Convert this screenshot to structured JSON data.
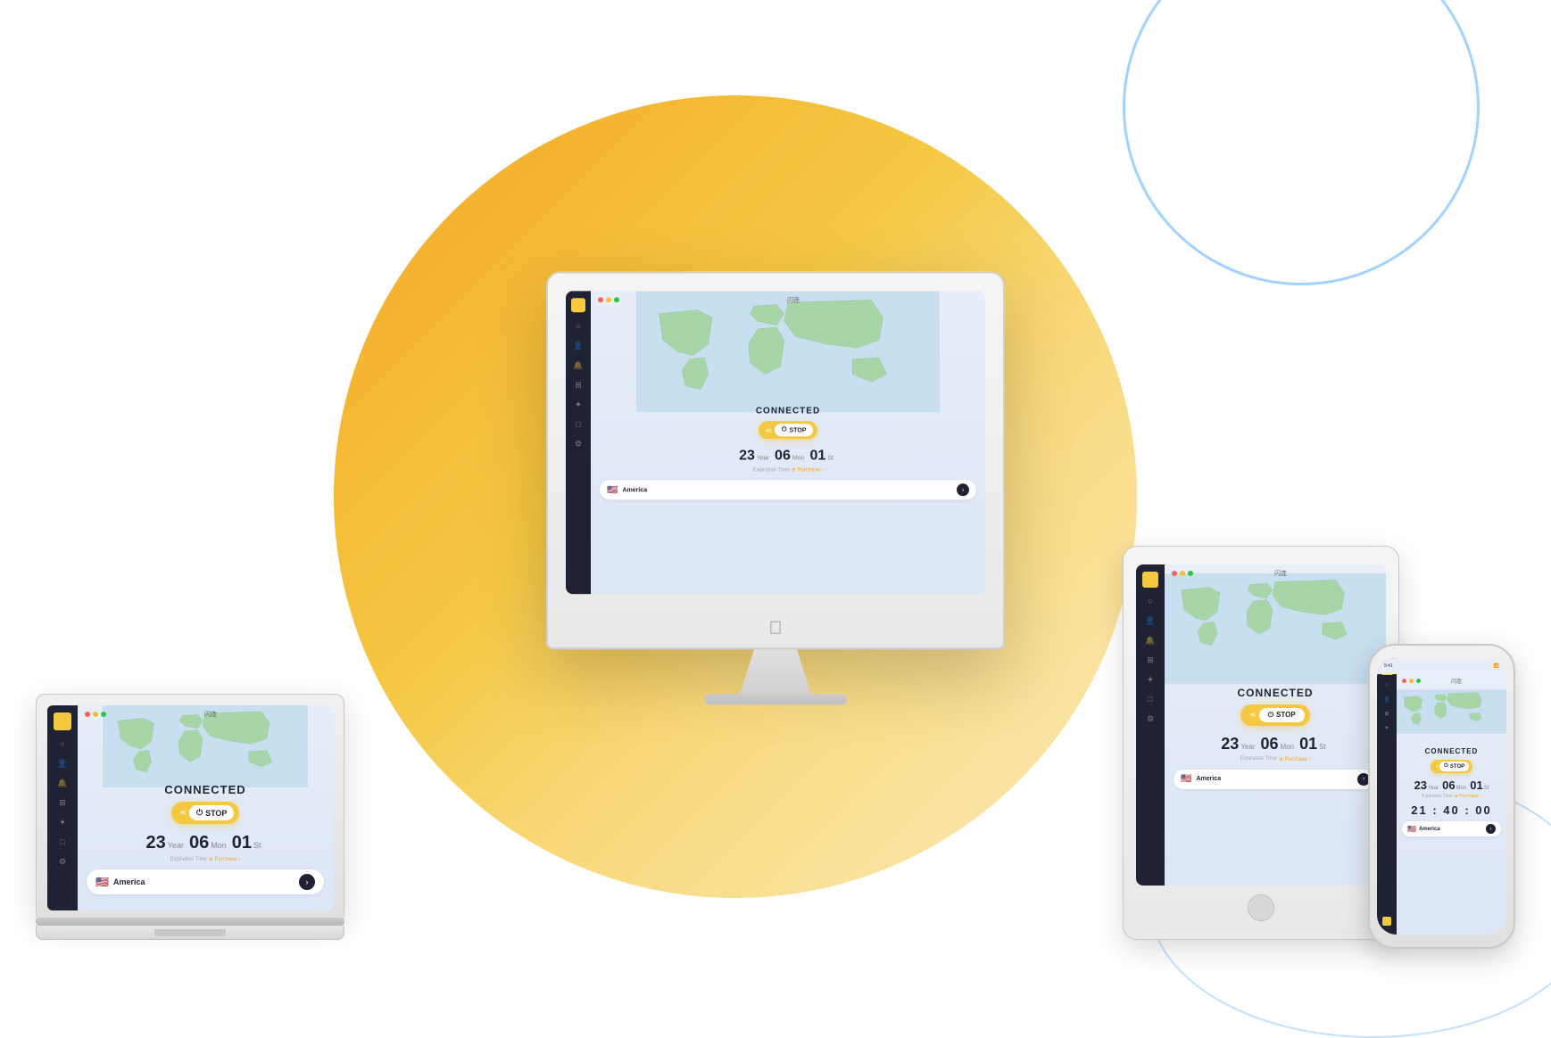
{
  "app": {
    "title": "闪连",
    "traffic_lights": [
      "red",
      "yellow",
      "green"
    ],
    "status": "CONNECTED",
    "button": {
      "chevrons": "<<",
      "stop_label": "STOP"
    },
    "expiry": {
      "year_num": "23",
      "year_unit": "Year",
      "month_num": "06",
      "month_unit": "Mon",
      "day_num": "01",
      "day_unit": "St",
      "label": "Expiration Time",
      "purchase_text": "⊕ Purchase ›"
    },
    "location": {
      "flag": "🇺🇸",
      "name": "America"
    }
  },
  "phone": {
    "timer": "21 : 40 : 00"
  },
  "sidebar_icons": [
    "●",
    "○",
    "👤",
    "🔔",
    "⊞",
    "✦",
    "□",
    "⚙"
  ],
  "colors": {
    "yellow": "#f5c842",
    "dark": "#1e2233",
    "map_land": "#a8d5a8",
    "map_water": "#c8dff0"
  }
}
